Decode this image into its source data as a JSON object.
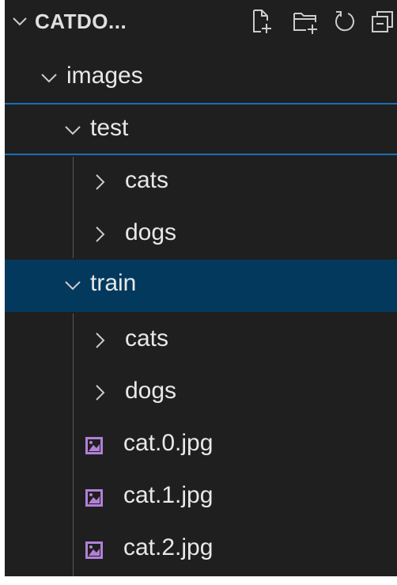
{
  "explorer": {
    "title": "CATDO...",
    "header_icons": [
      "new-file-icon",
      "new-folder-icon",
      "refresh-icon",
      "collapse-all-icon"
    ]
  },
  "tree": [
    {
      "label": "images",
      "kind": "folder",
      "expanded": true,
      "level": 1
    },
    {
      "label": "test",
      "kind": "folder",
      "expanded": true,
      "level": 2
    },
    {
      "label": "cats",
      "kind": "folder",
      "expanded": false,
      "level": 3
    },
    {
      "label": "dogs",
      "kind": "folder",
      "expanded": false,
      "level": 3
    },
    {
      "label": "train",
      "kind": "folder",
      "expanded": true,
      "level": 2,
      "selected": true
    },
    {
      "label": "cats",
      "kind": "folder",
      "expanded": false,
      "level": 3
    },
    {
      "label": "dogs",
      "kind": "folder",
      "expanded": false,
      "level": 3
    },
    {
      "label": "cat.0.jpg",
      "kind": "image-file",
      "level": 3
    },
    {
      "label": "cat.1.jpg",
      "kind": "image-file",
      "level": 3
    },
    {
      "label": "cat.2.jpg",
      "kind": "image-file",
      "level": 3
    }
  ],
  "colors": {
    "background": "#1f1f1f",
    "selected_row": "#04395e",
    "focus_border": "#1a6fb5",
    "text": "#e8e8e8",
    "image_icon": "#b180d7"
  }
}
